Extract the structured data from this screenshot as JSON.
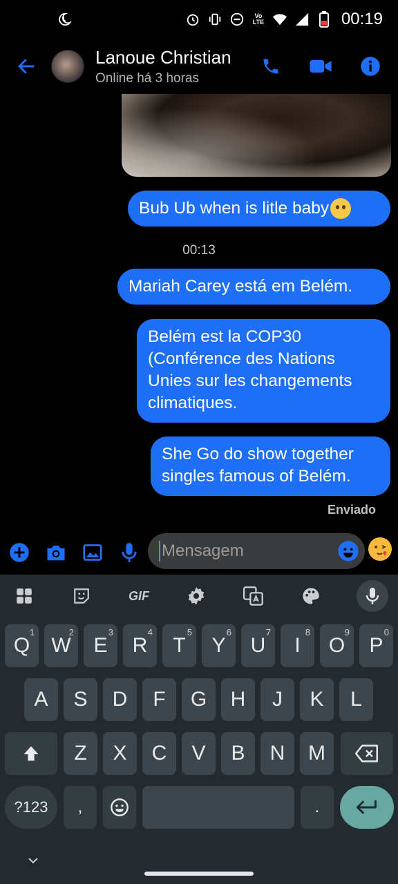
{
  "status_bar": {
    "time": "00:19",
    "icons": [
      "do-not-disturb-moon-icon",
      "alarm-icon",
      "vibrate-icon",
      "dnd-minus-icon",
      "volte-icon",
      "wifi-icon",
      "cellular-icon",
      "battery-low-icon"
    ],
    "volte_label": "Vo LTE"
  },
  "header": {
    "contact_name": "Lanoue Christian",
    "status": "Online há 3 horas"
  },
  "messages": [
    {
      "text": "Bub Ub when is  litle baby",
      "emoji": "smiling-cat-emoji"
    },
    {
      "text": "Mariah Carey está em Belém."
    },
    {
      "text": "Belém est la COP30 (Conférence des Nations Unies sur les changements climatiques."
    },
    {
      "text": "She Go do show together singles famous of Belém."
    }
  ],
  "timestamp": "00:13",
  "sent_status": "Enviado",
  "composer": {
    "placeholder": "Mensagem"
  },
  "keyboard": {
    "toolbar": [
      "apps-grid-icon",
      "sticker-icon",
      "GIF",
      "settings-gear-icon",
      "translate-icon",
      "palette-icon",
      "mic-icon"
    ],
    "gif_label": "GIF",
    "row1": [
      [
        "Q",
        "1"
      ],
      [
        "W",
        "2"
      ],
      [
        "E",
        "3"
      ],
      [
        "R",
        "4"
      ],
      [
        "T",
        "5"
      ],
      [
        "Y",
        "6"
      ],
      [
        "U",
        "7"
      ],
      [
        "I",
        "8"
      ],
      [
        "O",
        "9"
      ],
      [
        "P",
        "0"
      ]
    ],
    "row2": [
      "A",
      "S",
      "D",
      "F",
      "G",
      "H",
      "J",
      "K",
      "L"
    ],
    "row3": [
      "Z",
      "X",
      "C",
      "V",
      "B",
      "N",
      "M"
    ],
    "symbols_label": "?123",
    "comma": ",",
    "period": "."
  },
  "colors": {
    "accent": "#1f6ff6",
    "keyboard_bg": "#232b30",
    "key_bg": "#3c464c",
    "enter_bg": "#67a9a0"
  }
}
